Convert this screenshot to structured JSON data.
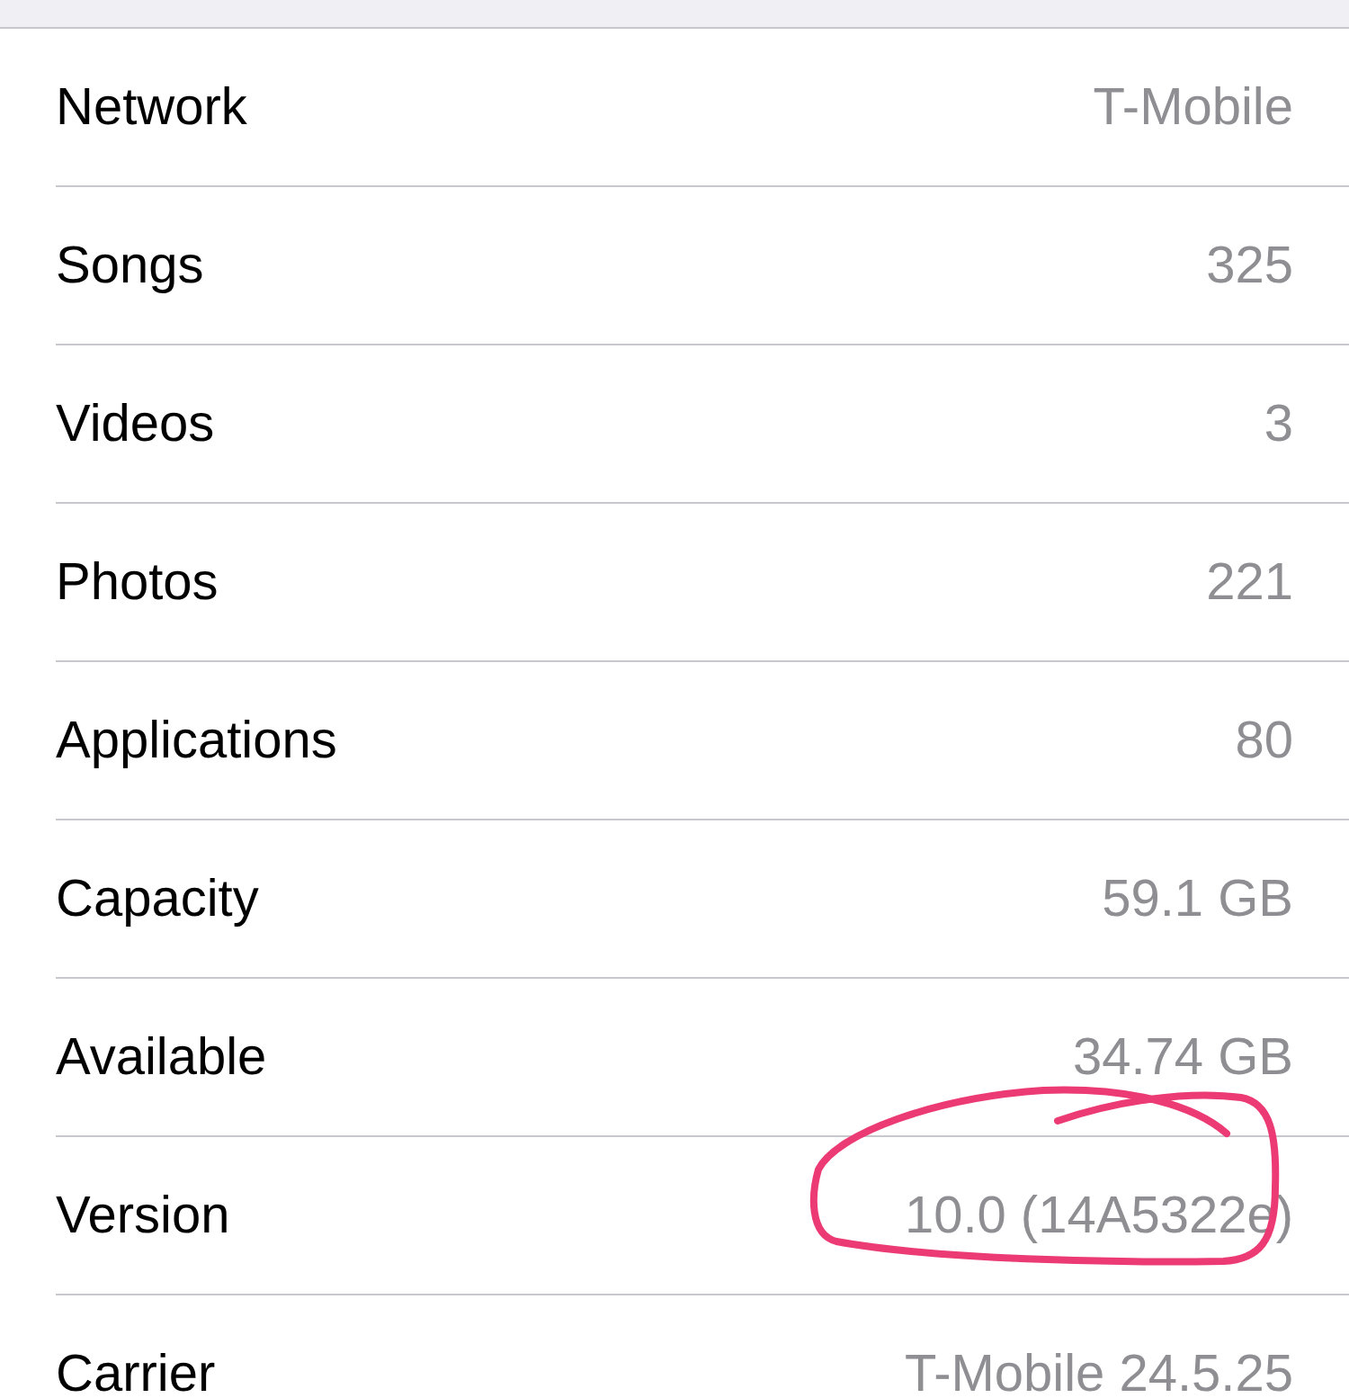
{
  "rows": [
    {
      "label": "Network",
      "value": "T-Mobile"
    },
    {
      "label": "Songs",
      "value": "325"
    },
    {
      "label": "Videos",
      "value": "3"
    },
    {
      "label": "Photos",
      "value": "221"
    },
    {
      "label": "Applications",
      "value": "80"
    },
    {
      "label": "Capacity",
      "value": "59.1 GB"
    },
    {
      "label": "Available",
      "value": "34.74 GB"
    },
    {
      "label": "Version",
      "value": "10.0 (14A5322e)"
    },
    {
      "label": "Carrier",
      "value": "T-Mobile 24.5.25"
    }
  ]
}
